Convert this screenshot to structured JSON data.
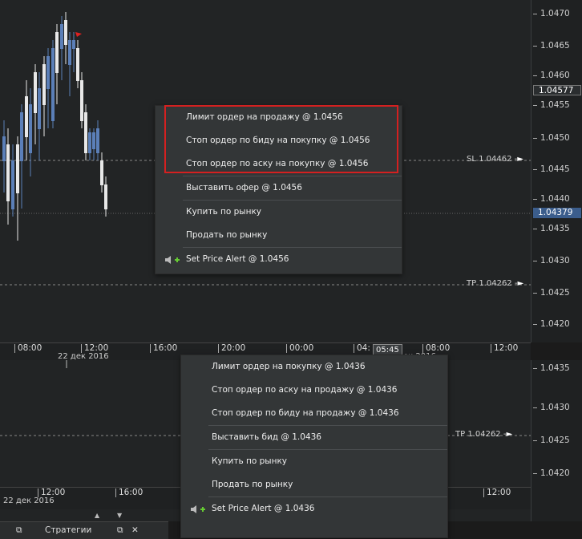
{
  "top_pane": {
    "price_ticks": [
      "1.0470",
      "1.0465",
      "1.0460",
      "1.0455",
      "1.0450",
      "1.0445",
      "1.0440",
      "1.0435",
      "1.0430",
      "1.0425",
      "1.0420"
    ],
    "price_box_white": "1.04577",
    "price_box_blue": "1.04379",
    "sl_label": "SL  1.04462 -",
    "tp_label": "TP  1.04262 -",
    "time_labels": [
      "08:00",
      "12:00",
      "16:00",
      "20:00",
      "00:00",
      "04:",
      "08:00",
      "12:00"
    ],
    "date_labels": [
      "22 дек 2016",
      "ек 2016"
    ],
    "cursor_time": "05:45",
    "menu": {
      "items": [
        "Лимит ордер на продажу @ 1.0456",
        "Стоп ордер по биду на покупку @ 1.0456",
        "Стоп ордер по аску на покупку @ 1.0456",
        "Выставить офер @ 1.0456",
        "Купить по рынку",
        "Продать по рынку",
        "Set Price Alert @ 1.0456"
      ]
    }
  },
  "bottom_pane": {
    "price_ticks": [
      "1.0435",
      "1.0430",
      "1.0425",
      "1.0420"
    ],
    "tp_label": "TP  1.04262 -",
    "time_labels": [
      "12:00",
      "16:00",
      "12:00"
    ],
    "date_label": "22 дек 2016",
    "menu": {
      "items": [
        "Лимит ордер на покупку @ 1.0436",
        "Стоп ордер по аску на продажу @ 1.0436",
        "Стоп ордер по биду на продажу @ 1.0436",
        "Выставить бид @ 1.0436",
        "Купить по рынку",
        "Продать по рынку",
        "Set Price Alert @ 1.0436"
      ]
    }
  },
  "tabs": {
    "strategies": "Стратегии",
    "scroll_up": "▲",
    "scroll_down": "▼"
  },
  "colors": {
    "bull_candle": "#5b7fb8",
    "bear_candle": "#e8e8e8",
    "highlight": "#d42020"
  }
}
